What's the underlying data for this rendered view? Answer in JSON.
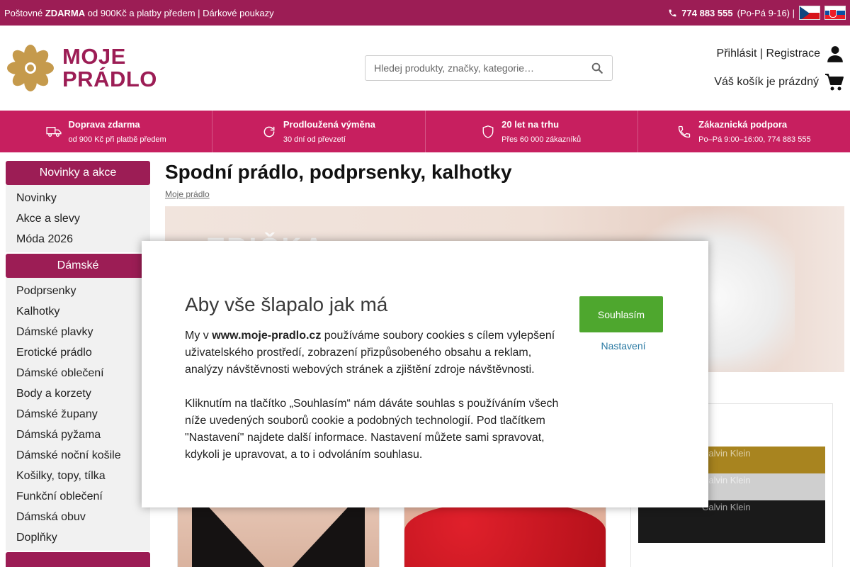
{
  "topbar": {
    "shipping_prefix": "Poštovné ",
    "shipping_free": "ZDARMA",
    "shipping_suffix": " od 900Kč a platby předem | Dárkové poukazy",
    "phone": "774 883 555",
    "hours": "(Po-Pá 9-16) |"
  },
  "header": {
    "logo_line1": "MOJE",
    "logo_line2": "PRÁDLO",
    "search_placeholder": "Hledej produkty, značky, kategorie…",
    "login_label": "Přihlásit | Registrace",
    "cart_label": "Váš košík je prázdný"
  },
  "benefits": [
    {
      "title": "Doprava zdarma",
      "subtitle": "od 900 Kč při platbě předem",
      "icon": "truck-icon"
    },
    {
      "title": "Prodloužená výměna",
      "subtitle": "30 dní od převzetí",
      "icon": "refresh-icon"
    },
    {
      "title": "20 let na trhu",
      "subtitle": "Přes 60 000 zákazníků",
      "icon": "shield-icon"
    },
    {
      "title": "Zákaznická podpora",
      "subtitle": "Po–Pá 9:00–16:00, 774 883 555",
      "icon": "phone-icon"
    }
  ],
  "sidebar": {
    "sections": [
      {
        "title": "Novinky a akce",
        "items": [
          "Novinky",
          "Akce a slevy",
          "Móda 2026"
        ]
      },
      {
        "title": "Dámské",
        "items": [
          "Podprsenky",
          "Kalhotky",
          "Dámské plavky",
          "Erotické prádlo",
          "Dámské oblečení",
          "Body a korzety",
          "Dámské župany",
          "Dámská pyžama",
          "Dámské noční košile",
          "Košilky, topy, tílka",
          "Funkční oblečení",
          "Dámská obuv",
          "Doplňky"
        ]
      }
    ]
  },
  "main": {
    "title": "Spodní prádlo, podprsenky, kalhotky",
    "breadcrumb": "Moje prádlo",
    "banner_text": "TRIČKA"
  },
  "products": {
    "brand_text": "Calvin Klein"
  },
  "cookie": {
    "title": "Aby vše šlapalo jak má",
    "p1_prefix": "My v ",
    "p1_domain": "www.moje-pradlo.cz",
    "p1_suffix": " používáme soubory cookies s cílem vylepšení uživatelského prostředí, zobrazení přizpůsobeného obsahu a reklam, analýzy návštěvnosti webových stránek a zjištění zdroje návštěvnosti.",
    "p2": "Kliknutím na tlačítko „Souhlasím“ nám dáváte souhlas s používáním všech níže uvedených souborů cookie a podobných technologií. Pod tlačítkem \"Nastavení\" najdete další informace. Nastavení můžete sami spravovat, kdykoli je upravovat, a to i odvoláním souhlasu.",
    "agree_label": "Souhlasím",
    "settings_label": "Nastavení"
  },
  "colors": {
    "brand": "#9c1d55",
    "benefit_bar": "#c71f5f",
    "logo_flower": "#c59a4c",
    "agree": "#4ea72e",
    "link": "#2b7aa3"
  }
}
